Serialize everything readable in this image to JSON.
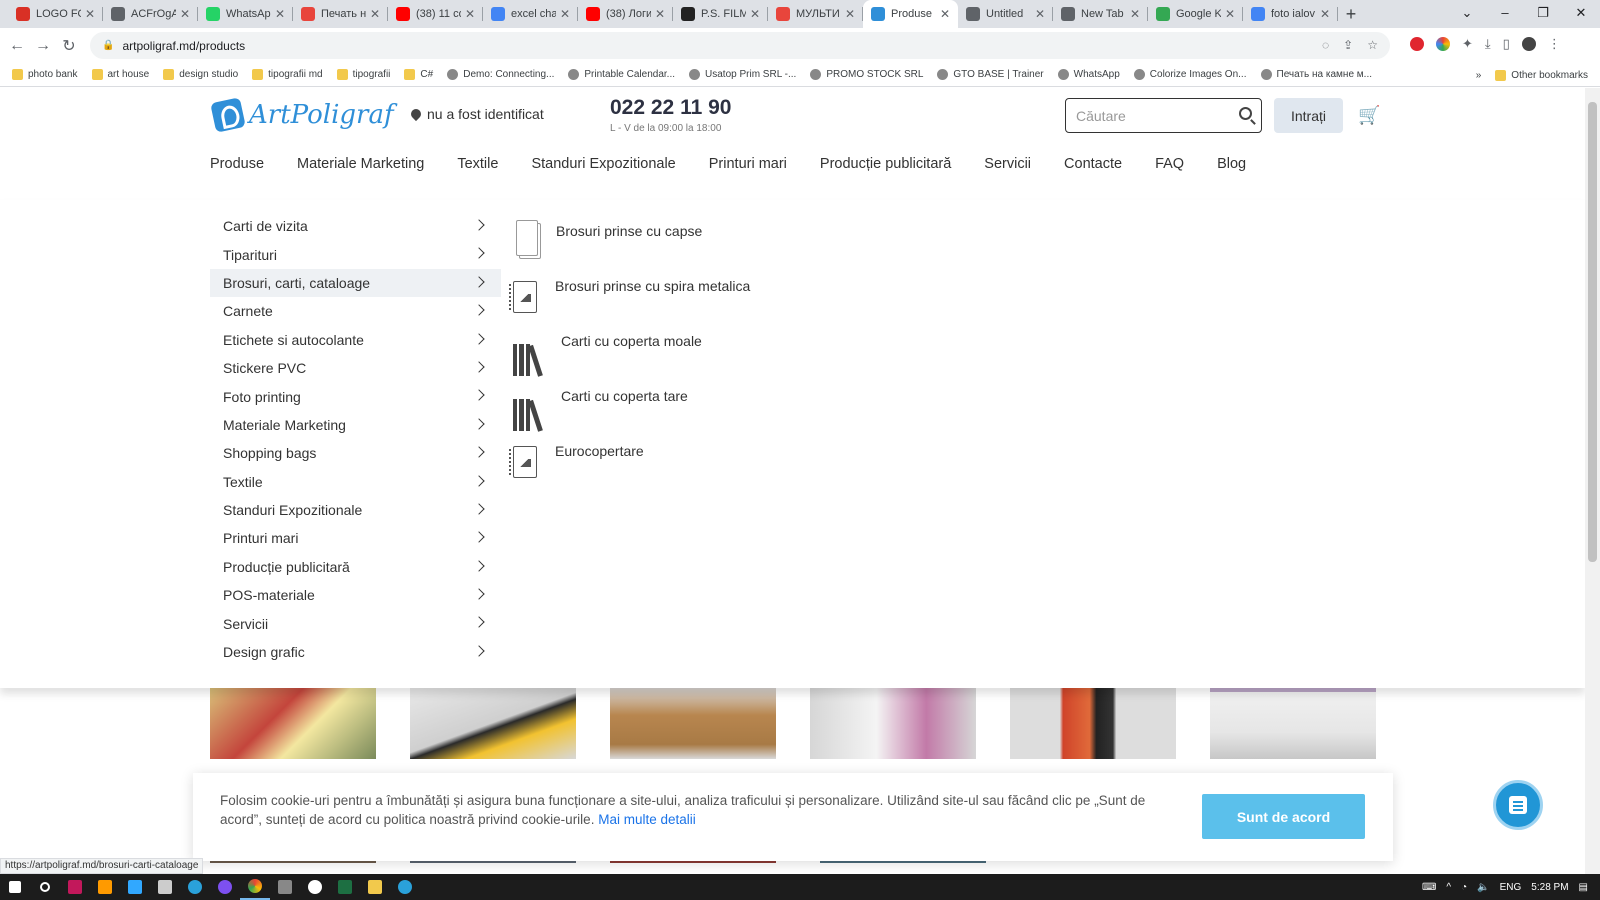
{
  "browser": {
    "tabs": [
      {
        "title": "LOGO FO",
        "color": "#d93025"
      },
      {
        "title": "ACFrOgA",
        "color": "#5f6368"
      },
      {
        "title": "WhatsApp",
        "color": "#25d366"
      },
      {
        "title": "Печать на",
        "color": "#e8453c"
      },
      {
        "title": "(38) 11 co",
        "color": "#ff0000"
      },
      {
        "title": "excel char",
        "color": "#4285f4"
      },
      {
        "title": "(38) Логи",
        "color": "#ff0000"
      },
      {
        "title": "P.S. FILM",
        "color": "#222"
      },
      {
        "title": "МУЛЬТИ",
        "color": "#e8453c"
      },
      {
        "title": "Produse",
        "color": "#2f8fd8"
      },
      {
        "title": "Untitled",
        "color": "#5f6368"
      },
      {
        "title": "New Tab",
        "color": "#5f6368"
      },
      {
        "title": "Google K",
        "color": "#34a853"
      },
      {
        "title": "foto ialov",
        "color": "#4285f4"
      }
    ],
    "active_tab_index": 9,
    "url": "artpoligraf.md/products",
    "bookmarks": [
      {
        "label": "photo bank",
        "folder": true
      },
      {
        "label": "art house",
        "folder": true
      },
      {
        "label": "design studio",
        "folder": true
      },
      {
        "label": "tipografii md",
        "folder": true
      },
      {
        "label": "tipografii",
        "folder": true
      },
      {
        "label": "C#",
        "folder": true
      },
      {
        "label": "Demo: Connecting...",
        "folder": false
      },
      {
        "label": "Printable Calendar...",
        "folder": false
      },
      {
        "label": "Usatop Prim SRL -...",
        "folder": false
      },
      {
        "label": "PROMO STOCK SRL",
        "folder": false
      },
      {
        "label": "GTO BASE | Trainer",
        "folder": false
      },
      {
        "label": "WhatsApp",
        "folder": false
      },
      {
        "label": "Colorize Images On...",
        "folder": false
      },
      {
        "label": "Печать на камне м...",
        "folder": false
      }
    ],
    "bookmarks_overflow": "»",
    "other_bookmarks": "Other bookmarks"
  },
  "site": {
    "logo_text": "ArtPoligraf",
    "location": "nu a fost identificat",
    "phone": "022 22 11 90",
    "hours": "L - V de la 09:00 la 18:00",
    "search_placeholder": "Căutare",
    "login_label": "Intrați",
    "main_nav": [
      "Produse",
      "Materiale Marketing",
      "Textile",
      "Standuri Expozitionale",
      "Printuri mari",
      "Producție publicitară",
      "Servicii",
      "Contacte",
      "FAQ",
      "Blog"
    ],
    "categories": [
      "Carti de vizita",
      "Tiparituri",
      "Brosuri, carti, cataloage",
      "Carnete",
      "Etichete si autocolante",
      "Stickere PVC",
      "Foto printing",
      "Materiale Marketing",
      "Shopping bags",
      "Textile",
      "Standuri Expozitionale",
      "Printuri mari",
      "Producție publicitară",
      "POS-materiale",
      "Servicii",
      "Design grafic"
    ],
    "active_category_index": 2,
    "subcategories": [
      {
        "label": "Brosuri prinse cu capse",
        "icon": "brochure-icon"
      },
      {
        "label": "Brosuri prinse cu spira metalica",
        "icon": "spiral-notebook-icon"
      },
      {
        "label": "Carti cu coperta moale",
        "icon": "books-icon"
      },
      {
        "label": "Carti cu coperta tare",
        "icon": "books-icon"
      },
      {
        "label": "Eurocopertare",
        "icon": "spiral-notebook-icon"
      }
    ],
    "cookie": {
      "text": "Folosim cookie-uri pentru a îmbunătăți și asigura buna funcționare a site-ului, analiza traficului și personalizare. Utilizând site-ul sau făcând clic pe „Sunt de acord”, sunteți de acord cu politica noastră privind cookie-urile.",
      "more_link": "Mai multe detalii",
      "accept": "Sunt de acord"
    },
    "status_url": "https://artpoligraf.md/brosuri-carti-cataloage"
  },
  "system": {
    "language": "ENG",
    "time": "5:28 PM"
  },
  "colors": {
    "brand": "#2f8fd8",
    "accept_button": "#5bc0eb",
    "chat_button": "#2196d6"
  }
}
